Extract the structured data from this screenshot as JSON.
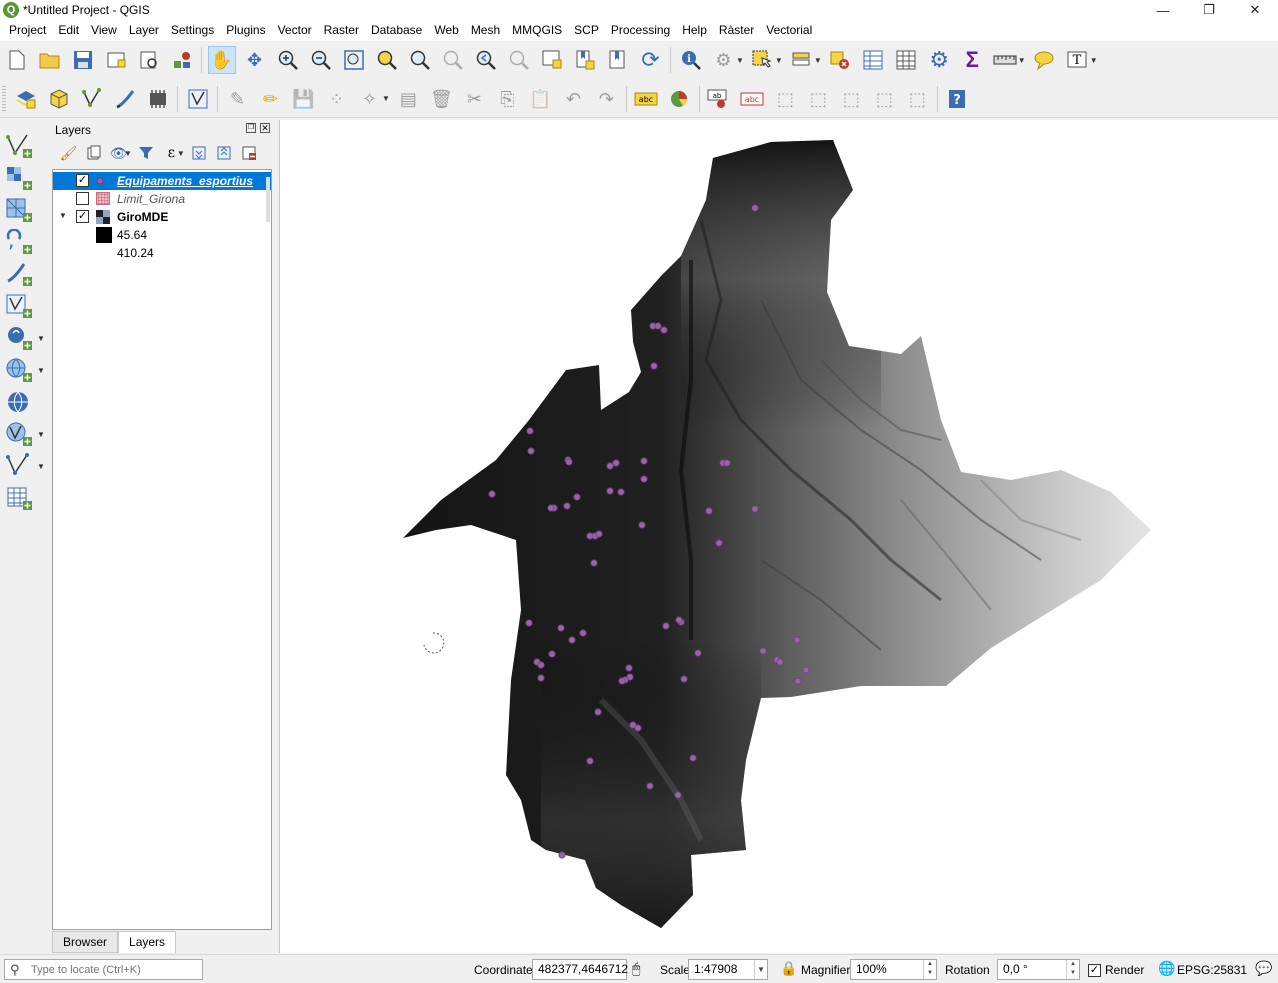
{
  "window": {
    "title": "*Untitled Project - QGIS",
    "logo": "Q"
  },
  "menu": [
    "Project",
    "Edit",
    "View",
    "Layer",
    "Settings",
    "Plugins",
    "Vector",
    "Raster",
    "Database",
    "Web",
    "Mesh",
    "MMQGIS",
    "SCP",
    "Processing",
    "Help",
    "Ràster",
    "Vectorial"
  ],
  "layers_panel": {
    "title": "Layers",
    "layers": [
      {
        "name": "Equipaments_esportius",
        "checked": true,
        "selected": true
      },
      {
        "name": "Limit_Girona",
        "checked": false,
        "selected": false
      },
      {
        "name": "GiroMDE",
        "checked": true,
        "selected": false
      }
    ],
    "legend": {
      "min": "45.64",
      "max": "410.24"
    },
    "tabs": [
      "Browser",
      "Layers"
    ],
    "active_tab": "Layers"
  },
  "status": {
    "locator_placeholder": "Type to locate (Ctrl+K)",
    "coordinate_label": "Coordinate",
    "coordinate": "482377,4646712",
    "scale_label": "Scale",
    "scale": "1:47908",
    "magnifier_label": "Magnifier",
    "magnifier": "100%",
    "rotation_label": "Rotation",
    "rotation": "0,0 °",
    "render_label": "Render",
    "render_checked": true,
    "crs": "EPSG:25831"
  },
  "colors": {
    "selection": "#0078d7",
    "point_fill": "#9a63a8",
    "point_stroke": "#6b3f7a",
    "dem_low": "#111111",
    "dem_high": "#f0f0f0"
  }
}
